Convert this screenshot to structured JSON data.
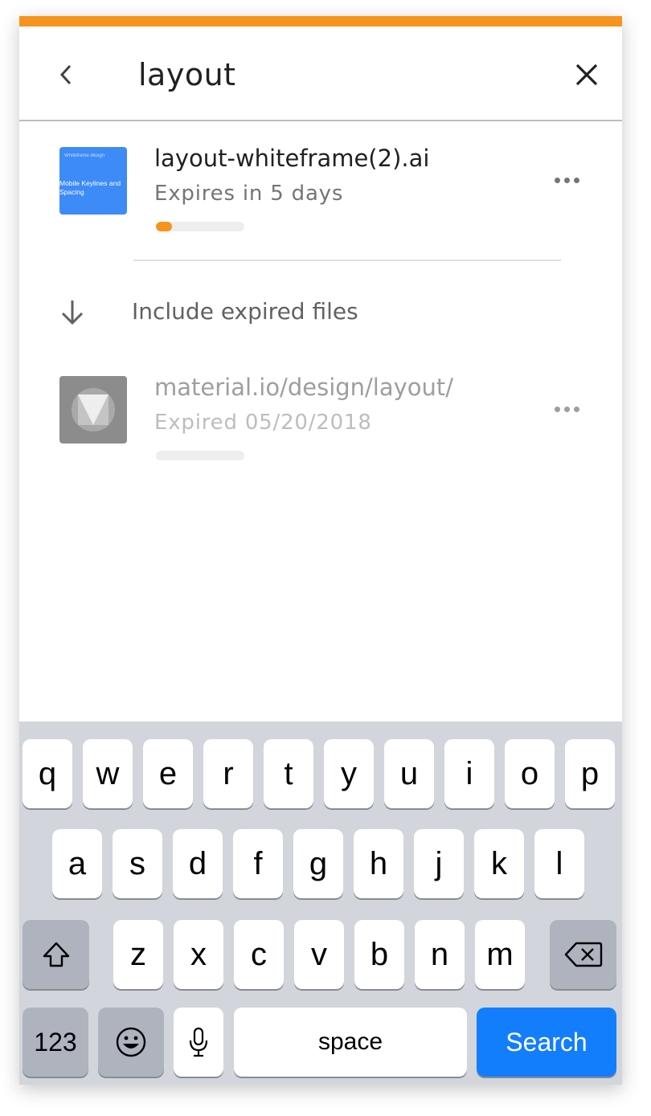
{
  "colors": {
    "accent": "#f7941d",
    "keyboard_bg": "#d2d5db",
    "search_key": "#127efc",
    "thumb_blue": "#3d8bf7"
  },
  "header": {
    "back_icon": "chevron-left-icon",
    "search_value": "layout",
    "close_icon": "close-icon"
  },
  "results": [
    {
      "title": "layout-whiteframe(2).ai",
      "subtitle": "Expires in 5 days",
      "thumbnail_small": "Whiteframe design",
      "thumbnail_text": "Mobile Keylines and Spacing",
      "progress": 0.18
    },
    {
      "title": "material.io/design/layout/",
      "subtitle": "Expired 05/20/2018",
      "thumbnail_icon": "material-logo-icon",
      "progress": 0.0
    }
  ],
  "expired_toggle": {
    "icon": "arrow-down-icon",
    "label": "Include expired files"
  },
  "keyboard": {
    "row1": [
      "q",
      "w",
      "e",
      "r",
      "t",
      "y",
      "u",
      "i",
      "o",
      "p"
    ],
    "row2": [
      "a",
      "s",
      "d",
      "f",
      "g",
      "h",
      "j",
      "k",
      "l"
    ],
    "row3": [
      "z",
      "x",
      "c",
      "v",
      "b",
      "n",
      "m"
    ],
    "numbers_label": "123",
    "space_label": "space",
    "search_label": "Search"
  }
}
